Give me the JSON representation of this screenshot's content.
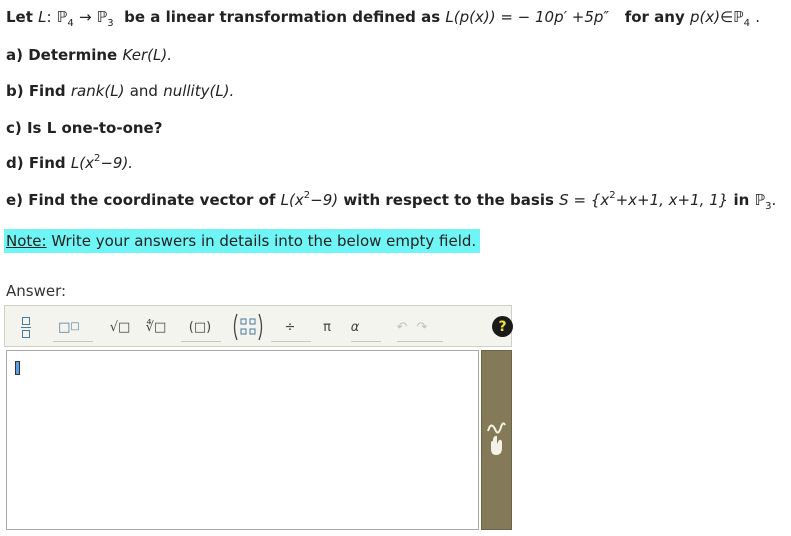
{
  "question": {
    "intro_let": "Let",
    "intro_L": "L",
    "intro_colon": ":",
    "space_from": "ℙ",
    "space_from_sub": "4",
    "arrow": "→",
    "space_to": "ℙ",
    "space_to_sub": "3",
    "intro_text": "be a linear transformation defined as",
    "definition": "L(p(x)) = − 10p′ +5p″",
    "for_any_text": "for any",
    "membership": "p(x)∈ℙ",
    "membership_sub": "4",
    "membership_end": ".",
    "part_a_label": "a) Determine",
    "part_a_expr": "Ker(L).",
    "part_b_label": "b) Find",
    "part_b_expr1": "rank(L)",
    "part_b_and": "and",
    "part_b_expr2": "nullity(L).",
    "part_c": "c) Is L one-to-one?",
    "part_d_label": "d) Find",
    "part_d_expr_pre": "L(x",
    "part_d_exp": "2",
    "part_d_expr_post": "−9).",
    "part_e_label": "e) Find the coordinate vector of",
    "part_e_expr_pre": "L(x",
    "part_e_exp": "2",
    "part_e_expr_post": "−9)",
    "part_e_mid": "with respect to the basis",
    "basis_pre": "S = {x",
    "basis_exp": "2",
    "basis_post": "+x+1, x+1, 1}",
    "part_e_in": "in",
    "part_e_space": "ℙ",
    "part_e_space_sub": "3",
    "part_e_end": "."
  },
  "note": {
    "label": "Note:",
    "text": " Write your answers in details into the below empty field."
  },
  "answer_label": "Answer:",
  "toolbar": {
    "fraction_icon": "fraction-icon",
    "superscript_text": "□",
    "superscript_exp": "□",
    "sqrt_text": "√□",
    "nthroot_text": "∜□",
    "parens_text": "(□)",
    "divide_text": "÷",
    "pi_text": "π",
    "alpha_text": "α",
    "undo_text": "↶",
    "redo_text": "↷",
    "help_text": "?"
  },
  "colors": {
    "note_highlight": "#6ff5f5",
    "side_panel": "#847a57",
    "help_bg": "#1a1a1a",
    "help_fg": "#f0e040"
  }
}
